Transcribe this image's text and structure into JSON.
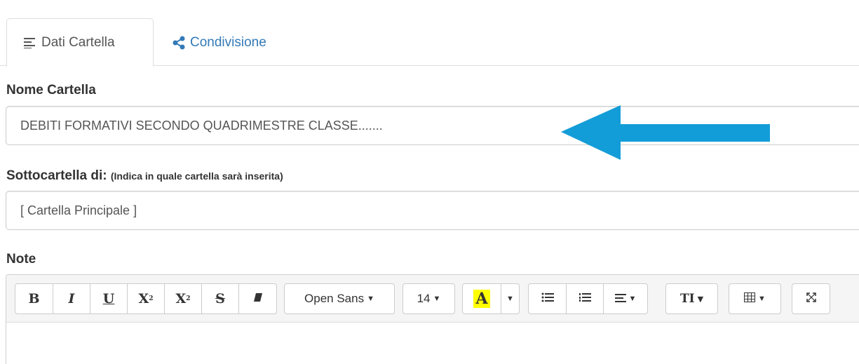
{
  "tabs": [
    {
      "label": "Dati Cartella",
      "icon": "align-left-icon",
      "active": true
    },
    {
      "label": "Condivisione",
      "icon": "share-icon",
      "active": false
    }
  ],
  "form": {
    "folder_name_label": "Nome Cartella",
    "folder_name_value": "DEBITI FORMATIVI SECONDO QUADRIMESTRE CLASSE.......",
    "parent_label": "Sottocartella di:",
    "parent_hint": "(Indica in quale cartella sarà inserita)",
    "parent_value": "[ Cartella Principale ]",
    "notes_label": "Note"
  },
  "toolbar": {
    "bold": "B",
    "italic": "I",
    "underline": "U",
    "superscript": "X",
    "subscript": "X",
    "strikethrough": "S",
    "font_name": "Open Sans",
    "font_size": "14",
    "color_letter": "A"
  },
  "colors": {
    "accent": "#337ab7",
    "arrow": "#139dd8",
    "highlight": "#ffff00"
  }
}
